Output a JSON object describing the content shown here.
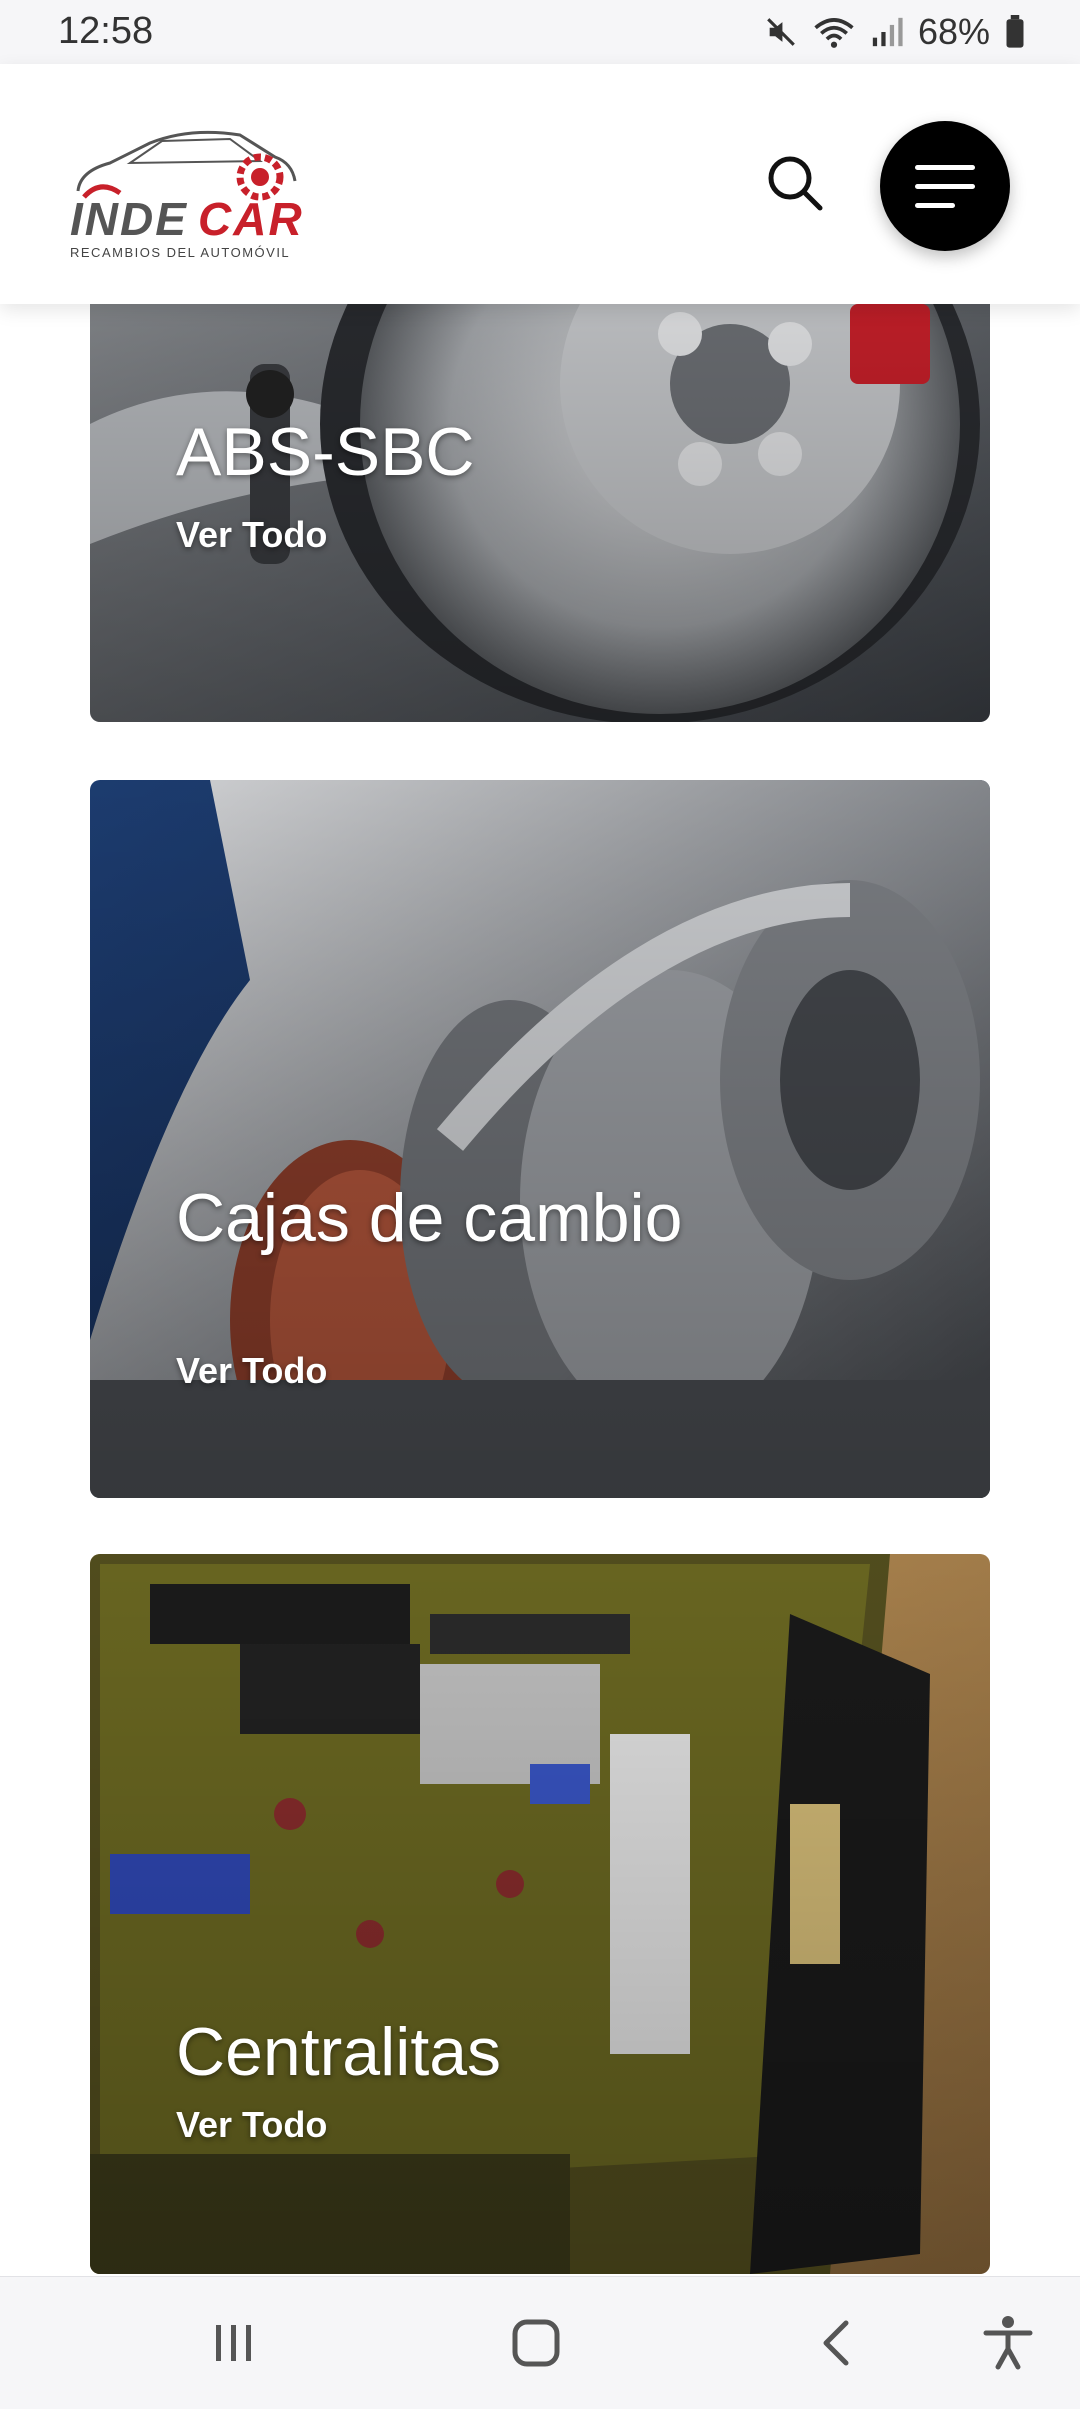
{
  "status_bar": {
    "time": "12:58",
    "battery_percent": "68%",
    "icons": [
      "mute-icon",
      "wifi-icon",
      "signal-icon",
      "battery-icon"
    ]
  },
  "header": {
    "logo_main": "INDECAR",
    "logo_tagline": "RECAMBIOS DEL AUTOMÓVIL",
    "search_icon": "search-icon",
    "menu_icon": "hamburger-menu-icon"
  },
  "categories": [
    {
      "title": "ABS-SBC",
      "link": "Ver Todo"
    },
    {
      "title": "Cajas de cambio",
      "link": "Ver Todo"
    },
    {
      "title": "Centralitas",
      "link": "Ver Todo"
    }
  ],
  "nav_bar": {
    "icons": [
      "recent-apps-icon",
      "home-icon",
      "back-icon",
      "accessibility-icon"
    ]
  },
  "colors": {
    "brand_red": "#c8202a",
    "menu_button": "#000000",
    "status_bar_bg": "#f6f6f8"
  }
}
